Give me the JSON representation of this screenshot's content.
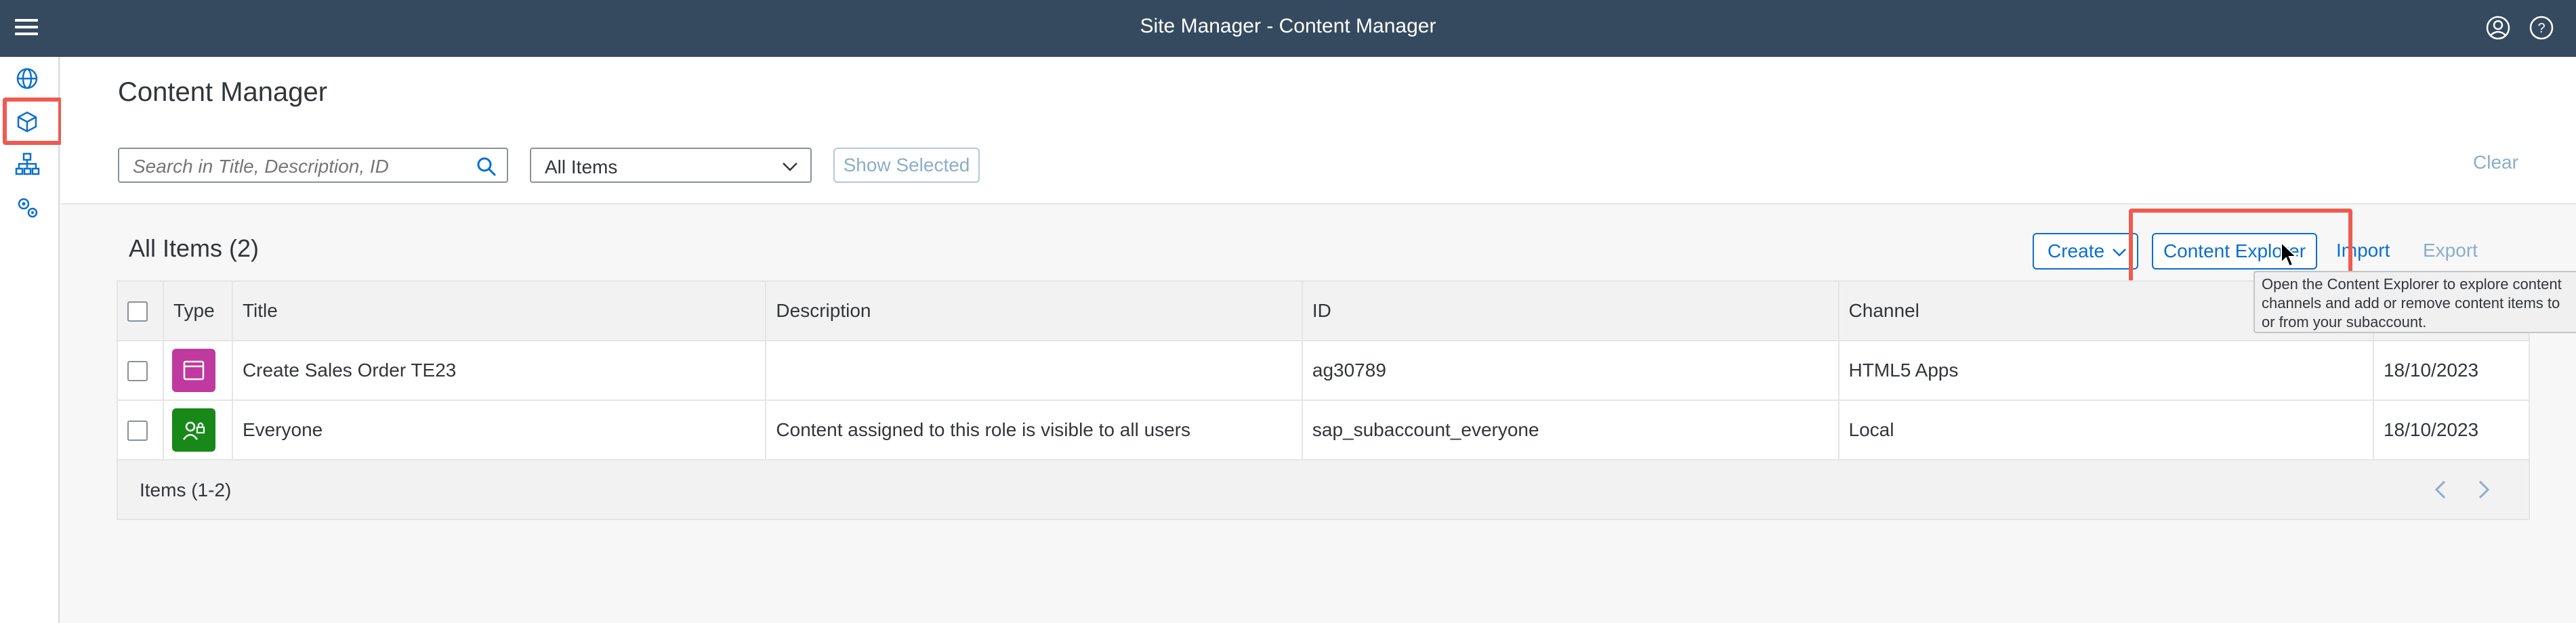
{
  "shell": {
    "title": "Site Manager - Content Manager",
    "icons": [
      "menu-icon",
      "user-icon",
      "help-icon"
    ]
  },
  "sidenav": {
    "items": [
      {
        "icon": "globe-icon",
        "label": "Site Directory"
      },
      {
        "icon": "cube-icon",
        "label": "Content Manager",
        "selected": true
      },
      {
        "icon": "hierarchy-icon",
        "label": "Provider Manager"
      },
      {
        "icon": "settings-icon",
        "label": "Settings"
      }
    ],
    "highlight_color": "#ee5b4f"
  },
  "header": {
    "title": "Content Manager",
    "search_placeholder": "Search in Title, Description, ID",
    "filter_value": "All Items",
    "show_selected_label": "Show Selected",
    "clear_label": "Clear"
  },
  "table": {
    "heading": "All Items (2)",
    "create_label": "Create",
    "explorer_label": "Content Explorer",
    "import_label": "Import",
    "export_label": "Export",
    "columns": [
      "Type",
      "Title",
      "Description",
      "ID",
      "Channel",
      ""
    ],
    "rows": [
      {
        "type_icon": "app-icon",
        "type_color": "#c0399f",
        "title": "Create Sales Order TE23",
        "description": "",
        "id": "ag30789",
        "channel": "HTML5 Apps",
        "date": "18/10/2023"
      },
      {
        "type_icon": "role-icon",
        "type_color": "#188918",
        "title": "Everyone",
        "description": "Content assigned to this role is visible to all users",
        "id": "sap_subaccount_everyone",
        "channel": "Local",
        "date": "18/10/2023"
      }
    ],
    "footer": "Items (1-2)"
  },
  "tooltip": {
    "line1": "Open the Content Explorer to explore content",
    "line2": "channels and add or remove content items to",
    "line3": "or from your subaccount."
  },
  "colors": {
    "shell_bg": "#354a5f",
    "accent": "#0a6ed1"
  }
}
